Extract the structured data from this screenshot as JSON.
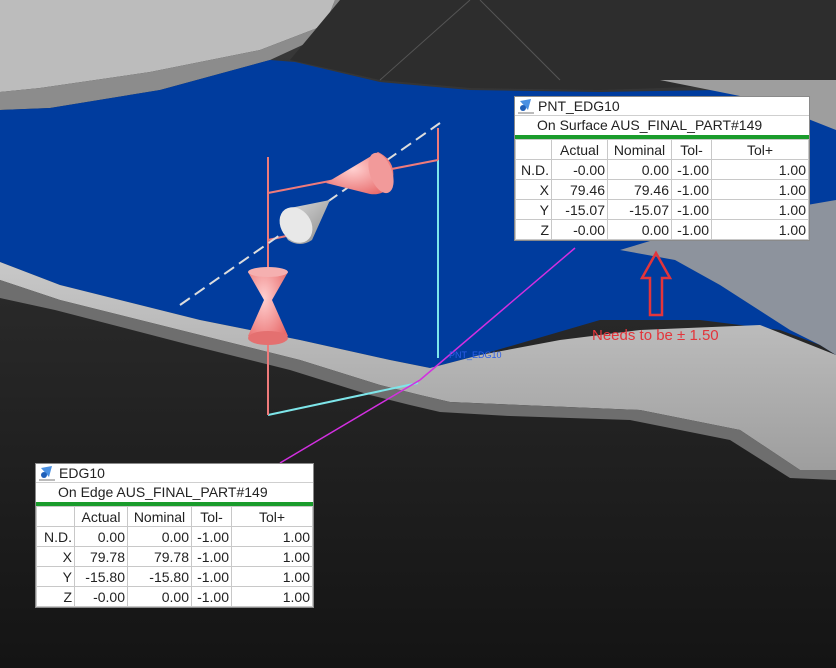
{
  "point_label": "PNT_EDG10",
  "annotation": "Needs to be ± 1.50",
  "upper_table": {
    "title": "PNT_EDG10",
    "feature": "On Surface AUS_FINAL_PART#149",
    "headers": [
      "",
      "Actual",
      "Nominal",
      "Tol-",
      "Tol+"
    ],
    "rows": [
      [
        "N.D.",
        "-0.00",
        "0.00",
        "-1.00",
        "1.00"
      ],
      [
        "X",
        "79.46",
        "79.46",
        "-1.00",
        "1.00"
      ],
      [
        "Y",
        "-15.07",
        "-15.07",
        "-1.00",
        "1.00"
      ],
      [
        "Z",
        "-0.00",
        "0.00",
        "-1.00",
        "1.00"
      ]
    ]
  },
  "lower_table": {
    "title": "EDG10",
    "feature": "On Edge AUS_FINAL_PART#149",
    "headers": [
      "",
      "Actual",
      "Nominal",
      "Tol-",
      "Tol+"
    ],
    "rows": [
      [
        "N.D.",
        "0.00",
        "0.00",
        "-1.00",
        "1.00"
      ],
      [
        "X",
        "79.78",
        "79.78",
        "-1.00",
        "1.00"
      ],
      [
        "Y",
        "-15.80",
        "-15.80",
        "-1.00",
        "1.00"
      ],
      [
        "Z",
        "-0.00",
        "0.00",
        "-1.00",
        "1.00"
      ]
    ]
  },
  "colors": {
    "surface_blue": "#003c9e",
    "part_grey": "#b4b4b4",
    "background": "#1c1c1c",
    "probe_salmon": "#ef7b7b",
    "leader_magenta": "#d22fe0",
    "axis_cyan": "#7ee6ea",
    "status_green": "#1a9c2c",
    "annotation_red": "#e3353b"
  }
}
